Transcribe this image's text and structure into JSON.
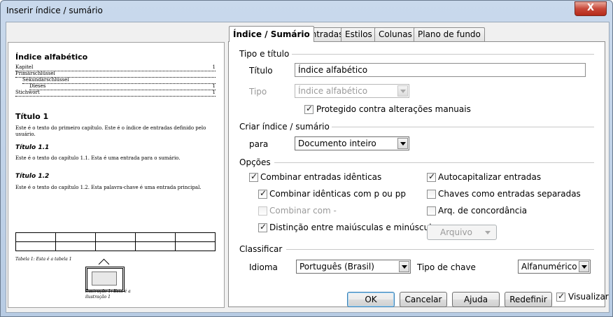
{
  "window": {
    "title": "Inserir índice / sumário",
    "close_label": "X"
  },
  "tabs": [
    "Índice / Sumário",
    "Entradas",
    "Estilos",
    "Colunas",
    "Plano de fundo"
  ],
  "preview": {
    "heading": "Índice alfabético",
    "index_rows": [
      {
        "text": "Kapitel",
        "page": "1"
      },
      {
        "text": "Primärschlüssel",
        "page": ""
      },
      {
        "text": "Sekundärschlüssel",
        "page": ""
      },
      {
        "text": "Dieses",
        "page": "1"
      },
      {
        "text": "Stichwort",
        "page": "1"
      }
    ],
    "title1": "Título 1",
    "text1": "Este é o texto do primeiro capítulo. Este é o índice de entradas definido pelo usuário.",
    "title11": "Título 1.1",
    "text11": "Este é o texto do capítulo 1.1. Esta é uma entrada para o sumário.",
    "title12": "Título 1.2",
    "text12": "Este é o texto do capítulo 1.2. Esta palavra-chave é uma entrada principal.",
    "table_caption": "Tabela 1: Esta é a tabela 1",
    "illustration_caption": "Ilustração 1: Esta é a ilustração 1"
  },
  "type_section": {
    "header": "Tipo e título",
    "title_label": "Título",
    "title_value": "Índice alfabético",
    "type_label": "Tipo",
    "type_value": "Índice alfabético",
    "protected_label": "Protegido contra alterações manuais",
    "protected_checked": true
  },
  "create_section": {
    "header": "Criar índice / sumário",
    "for_label": "para",
    "for_value": "Documento inteiro"
  },
  "options_section": {
    "header": "Opções",
    "combine_identical": {
      "label": "Combinar entradas idênticas",
      "checked": true
    },
    "combine_p_pp": {
      "label": "Combinar idênticas com p ou pp",
      "checked": true
    },
    "combine_with": {
      "label": "Combinar com -",
      "checked": false
    },
    "case_sensitive": {
      "label": "Distinção entre maiúsculas e minúsculas",
      "checked": true
    },
    "autocapitalize": {
      "label": "Autocapitalizar entradas",
      "checked": true
    },
    "keys_separate": {
      "label": "Chaves como entradas separadas",
      "checked": false
    },
    "concordance": {
      "label": "Arq. de concordância",
      "checked": false
    },
    "file_button": "Arquivo"
  },
  "sort_section": {
    "header": "Classificar",
    "language_label": "Idioma",
    "language_value": "Português (Brasil)",
    "key_type_label": "Tipo de chave",
    "key_type_value": "Alfanumérico"
  },
  "buttons": {
    "ok": "OK",
    "cancel": "Cancelar",
    "help": "Ajuda",
    "reset": "Redefinir",
    "preview_label": "Visualizar",
    "preview_checked": true
  }
}
